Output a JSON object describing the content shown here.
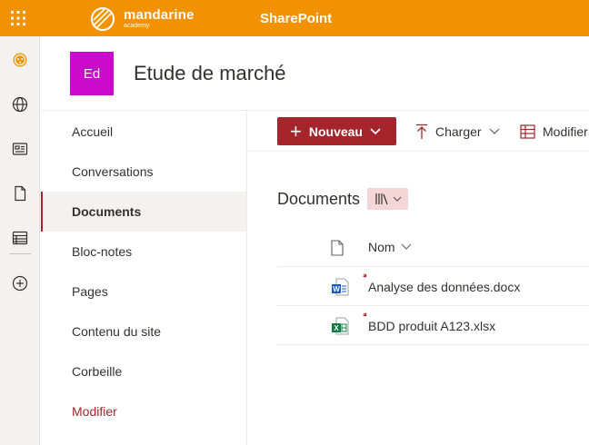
{
  "topbar": {
    "brand_name": "mandarine",
    "brand_sub": "academy",
    "app_name": "SharePoint",
    "colors": {
      "bar": "#f39200",
      "text": "#ffffff"
    }
  },
  "appbar": {
    "items": [
      "home-icon",
      "globe-icon",
      "news-icon",
      "document-icon",
      "lists-icon",
      "add-icon"
    ]
  },
  "site": {
    "logo_text": "Ed",
    "title": "Etude de marché",
    "logo_color": "#cb0bca"
  },
  "nav": {
    "items": [
      {
        "label": "Accueil"
      },
      {
        "label": "Conversations"
      },
      {
        "label": "Documents",
        "selected": true
      },
      {
        "label": "Bloc-notes"
      },
      {
        "label": "Pages"
      },
      {
        "label": "Contenu du site"
      },
      {
        "label": "Corbeille"
      },
      {
        "label": "Modifier"
      }
    ],
    "accent": "#a4262c"
  },
  "commandbar": {
    "new_label": "Nouveau",
    "upload_label": "Charger",
    "edit_label": "Modifier"
  },
  "library": {
    "title": "Documents",
    "column_name": "Nom",
    "files": [
      {
        "name": "Analyse des données.docx",
        "type": "word"
      },
      {
        "name": "BDD produit A123.xlsx",
        "type": "excel"
      }
    ]
  }
}
